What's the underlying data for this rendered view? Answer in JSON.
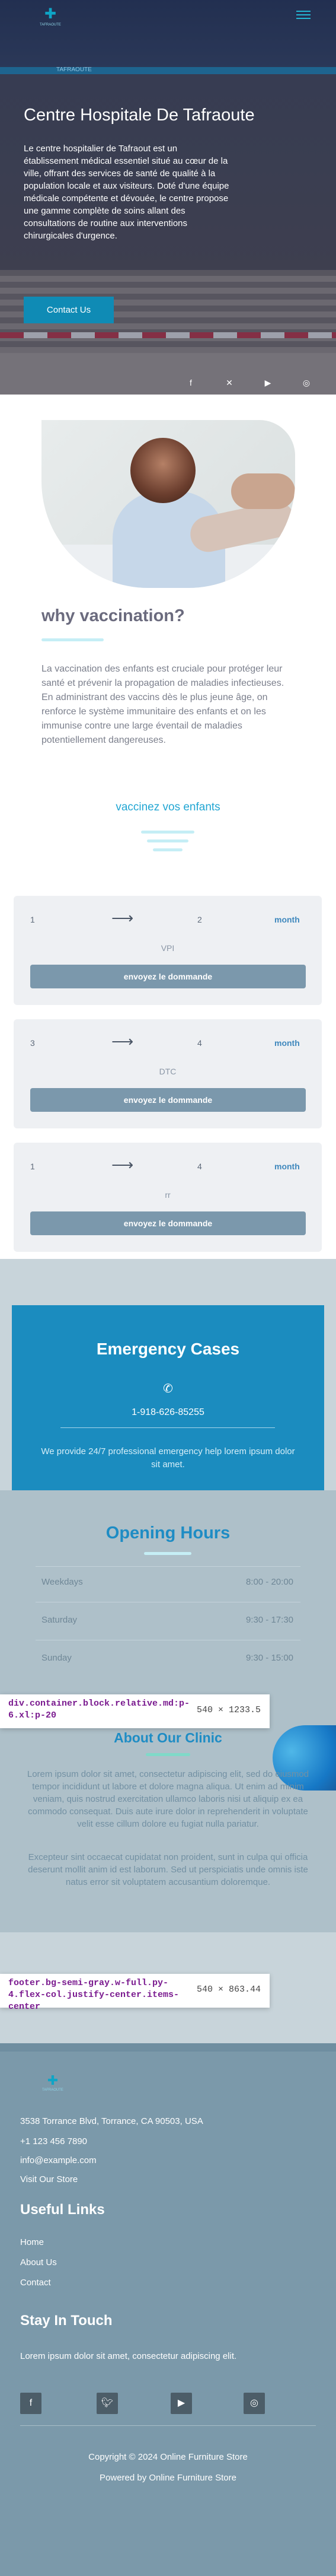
{
  "colors": {
    "accent": "#0f8bb5",
    "heading_blue": "#1e8cc4",
    "emergency_bg": "#1b8cbf",
    "footer_bg": "#7b99aa",
    "button_gray": "#7b98ac"
  },
  "header": {
    "logo_icon": "cross-logo-icon",
    "logo_text": "TAFRAOUTE",
    "menu_icon": "hamburger-menu-icon",
    "strip_text": "TAFRAOUTE"
  },
  "hero": {
    "title": "Centre Hospitale De Tafraoute",
    "text": "Le centre hospitalier de Tafraout est un établissement médical essentiel situé au cœur de la ville, offrant des services de santé de qualité à la population locale et aux visiteurs. Doté d'une équipe médicale compétente et dévouée, le centre propose une gamme complète de soins allant des consultations de routine aux interventions chirurgicales d'urgence.",
    "cta": "Contact Us",
    "social": [
      "facebook-icon",
      "x-icon",
      "youtube-icon",
      "instagram-icon"
    ]
  },
  "why": {
    "title": "why vaccination?",
    "text": "La vaccination des enfants est cruciale pour protéger leur santé et prévenir la propagation de maladies infectieuses. En administrant des vaccins dès le plus jeune âge, on renforce le système immunitaire des enfants et on les immunise contre une large éventail de maladies potentiellement dangereuses."
  },
  "vaccines": {
    "title": "vaccinez vos enfants",
    "cards": [
      {
        "from": "1",
        "to": "2",
        "unit": "month",
        "name": "VPI",
        "button": "envoyez le dommande"
      },
      {
        "from": "3",
        "to": "4",
        "unit": "month",
        "name": "DTC",
        "button": "envoyez le dommande"
      },
      {
        "from": "1",
        "to": "4",
        "unit": "month",
        "name": "rr",
        "button": "envoyez le dommande"
      }
    ]
  },
  "emergency": {
    "title": "Emergency Cases",
    "phone_icon": "phone-icon",
    "phone": "1-918-626-85255",
    "text": "We provide 24/7 professional emergency help lorem ipsum dolor sit amet."
  },
  "hours": {
    "title": "Opening Hours",
    "rows": [
      {
        "day": "Weekdays",
        "time": "8:00 - 20:00"
      },
      {
        "day": "Saturday",
        "time": "9:30 - 17:30"
      },
      {
        "day": "Sunday",
        "time": "9:30 - 15:00"
      }
    ]
  },
  "devtools": {
    "tag1_selector": "div.container.block.relative.md:p-6.xl:p-20",
    "tag1_size": "540 × 1233.5",
    "tag2_selector": "footer.bg-semi-gray.w-full.py-4.flex-col.justify-center.items-center",
    "tag2_size": "540 × 863.44"
  },
  "about": {
    "title": "About Our Clinic",
    "p1": "Lorem ipsum dolor sit amet, consectetur adipiscing elit, sed do eiusmod tempor incididunt ut labore et dolore magna aliqua. Ut enim ad minim veniam, quis nostrud exercitation ullamco laboris nisi ut aliquip ex ea commodo consequat. Duis aute irure dolor in reprehenderit in voluptate velit esse cillum dolore eu fugiat nulla pariatur.",
    "p2": "Excepteur sint occaecat cupidatat non proident, sunt in culpa qui officia deserunt mollit anim id est laborum. Sed ut perspiciatis unde omnis iste natus error sit voluptatem accusantium doloremque."
  },
  "footer": {
    "logo_icon": "cross-logo-icon",
    "logo_text": "TAFRAOUTE",
    "address": "3538 Torrance Blvd, Torrance, CA 90503, USA",
    "phone": "+1 123 456 7890",
    "email": "info@example.com",
    "visit": "Visit Our Store",
    "links_title": "Useful Links",
    "links": [
      "Home",
      "About Us",
      "Contact"
    ],
    "touch_title": "Stay In Touch",
    "touch_text": "Lorem ipsum dolor sit amet, consectetur adipiscing elit.",
    "social": [
      "facebook-icon",
      "twitter-icon",
      "youtube-icon",
      "instagram-icon"
    ],
    "copyright": "Copyright © 2024 Online Furniture Store",
    "powered": "Powered by Online Furniture Store"
  }
}
